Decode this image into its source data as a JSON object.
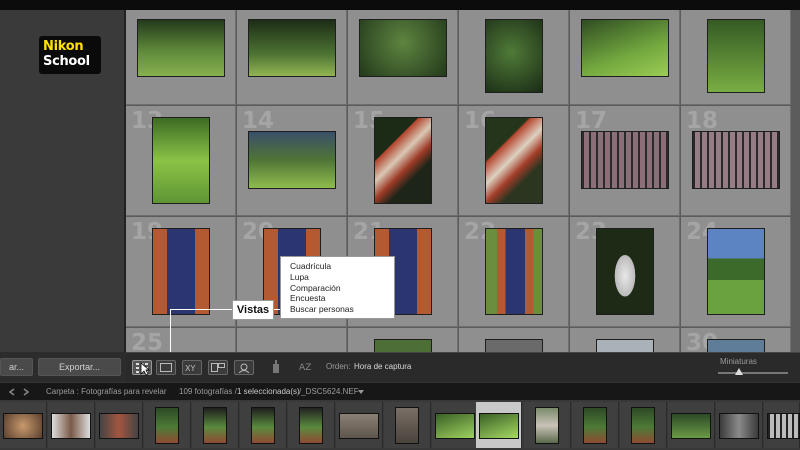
{
  "logo": {
    "line1": "Nikon",
    "line2": "School"
  },
  "left_buttons": {
    "import_label": "ar...",
    "export_label": "Exportar..."
  },
  "grid": {
    "row_numbers": [
      "13",
      "14",
      "15",
      "16",
      "17",
      "18",
      "19",
      "20",
      "21",
      "22",
      "23",
      "24",
      "25",
      "30"
    ]
  },
  "views_menu": {
    "callout_label": "Vistas",
    "items": [
      "Cuadrícula",
      "Lupa",
      "Comparación",
      "Encuesta",
      "Buscar personas"
    ]
  },
  "toolbar": {
    "sort_label": "Orden:",
    "sort_value": "Hora de captura",
    "thumbs_label": "Miniaturas",
    "thumbnail_size": 0.3
  },
  "filmstrip_header": {
    "folder": "Carpeta : Fotografías para revelar",
    "count_prefix": "109 fotografías /",
    "selected": "1 seleccionada(s)",
    "filename": "/_DSC5624.NEF"
  },
  "colors": {
    "logo_yellow": "#ffe100",
    "grid_cell": "#8f8f8f",
    "selected_cell": "#c9c9c9"
  }
}
